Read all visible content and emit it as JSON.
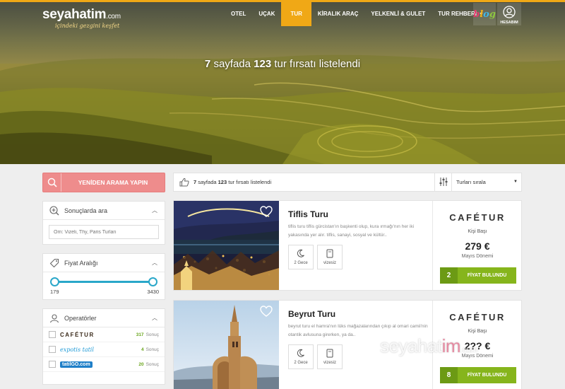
{
  "brand": {
    "name": "seyahatim",
    "domain": ".com",
    "tagline": "içindeki gezgini keşfet"
  },
  "nav": {
    "items": [
      {
        "label": "OTEL",
        "active": false
      },
      {
        "label": "UÇAK",
        "active": false
      },
      {
        "label": "TUR",
        "active": true
      },
      {
        "label": "KİRALIK ARAÇ",
        "active": false
      },
      {
        "label": "YELKENLİ & GULET",
        "active": false
      },
      {
        "label": "TUR REHBERİ",
        "active": false
      }
    ],
    "blog_label": "blog",
    "account_label": "HESABIM"
  },
  "hero": {
    "pages": "7",
    "pages_text": "sayfada",
    "count": "123",
    "suffix": "tur fırsatı listelendi"
  },
  "sidebar": {
    "search_button": "YENİDEN ARAMA YAPIN",
    "search_panel": {
      "title": "Sonuçlarda ara",
      "placeholder": "Örn: Vizeli, Thy, Paris Turları"
    },
    "price_panel": {
      "title": "Fiyat Aralığı",
      "min": "179",
      "max": "3430"
    },
    "operators_panel": {
      "title": "Operatörler",
      "items": [
        {
          "name": "CAFÉTUR",
          "count": "317",
          "unit": "Sonuç",
          "color": "#3a2a1a"
        },
        {
          "name": "expotis tatil",
          "count": "4",
          "unit": "Sonuç",
          "color": "#1f9ad6"
        },
        {
          "name": "tatilGO.com",
          "count": "20",
          "unit": "Sonuç",
          "color": "#1f7fc8"
        }
      ]
    }
  },
  "results_bar": {
    "pages": "7",
    "pages_text": "sayfada",
    "count": "123",
    "suffix": "tur fırsatı listelendi",
    "sort_label": "Turları sırala"
  },
  "tours": [
    {
      "title": "Tiflis Turu",
      "description": "tiflis turu tiflis gürcistan'ın başkenti olup, kura ırmağı'nın her iki yakasında yer alır. tiflis, sanayi, sosyal ve kültür..",
      "nights": "2 Gece",
      "visa": "vizesiz",
      "operator": "CAFÉTUR",
      "per_person": "Kişi Başı",
      "price": "279 €",
      "season": "Mayıs Dönemi",
      "price_count": "2",
      "price_button": "FİYAT BULUNDU"
    },
    {
      "title": "Beyrut Turu",
      "description": "beyrut turu el hamra'nın lüks mağazalarından çıkıp al omari camii'nin otantik avlusuna girerken, ya da..",
      "nights": "2 Gece",
      "visa": "vizesiz",
      "operator": "CAFÉTUR",
      "per_person": "Kişi Başı",
      "price": "2?? €",
      "season": "Mayıs Dönemi",
      "price_count": "8",
      "price_button": "FİYAT BULUNDU"
    }
  ],
  "watermark": {
    "main": "seyahat",
    "im": "im",
    "domain": ".com"
  },
  "colors": {
    "accent": "#f0a816",
    "search_button": "#ee8c8c",
    "slider": "#2aa7c9",
    "price_button": "#86b51c"
  }
}
